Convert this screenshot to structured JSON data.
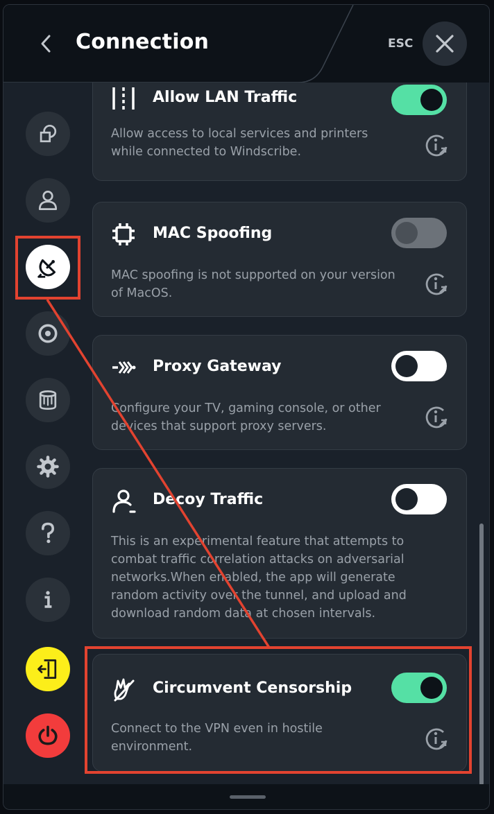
{
  "header": {
    "title": "Connection",
    "esc_label": "ESC",
    "back_icon": "chevron-left-icon",
    "close_icon": "close-icon"
  },
  "sidebar": {
    "items": [
      {
        "name": "general",
        "icon": "windows-icon"
      },
      {
        "name": "account",
        "icon": "user-icon"
      },
      {
        "name": "connection",
        "icon": "satellite-dish-icon",
        "active": true
      },
      {
        "name": "robert",
        "icon": "robert-icon"
      },
      {
        "name": "advanced",
        "icon": "database-icon"
      },
      {
        "name": "preferences",
        "icon": "gear-icon"
      },
      {
        "name": "help",
        "icon": "question-icon"
      },
      {
        "name": "about",
        "icon": "info-icon"
      },
      {
        "name": "logout",
        "icon": "exit-door-icon"
      },
      {
        "name": "quit",
        "icon": "power-icon"
      }
    ]
  },
  "settings": [
    {
      "id": "allow-lan-traffic",
      "title": "Allow LAN Traffic",
      "description": "Allow access to local services and printers while connected to Windscribe.",
      "toggle": "on",
      "icon": "lan-icon"
    },
    {
      "id": "mac-spoofing",
      "title": "MAC Spoofing",
      "description": "MAC spoofing is not supported on your version of MacOS.",
      "toggle": "disabled",
      "icon": "chip-icon"
    },
    {
      "id": "proxy-gateway",
      "title": "Proxy Gateway",
      "description": "Configure your TV, gaming console, or other devices that support proxy servers.",
      "toggle": "off",
      "icon": "proxy-icon"
    },
    {
      "id": "decoy-traffic",
      "title": "Decoy Traffic",
      "description": "This is an experimental feature that attempts to combat traffic correlation attacks on adversarial networks.When enabled, the app will generate random activity over the tunnel, and upload and download random data at chosen intervals.",
      "toggle": "off",
      "icon": "decoy-user-icon"
    },
    {
      "id": "circumvent-censorship",
      "title": "Circumvent Censorship",
      "description": "Connect to the VPN even in hostile environment.",
      "toggle": "on",
      "icon": "circumvent-hand-icon"
    }
  ],
  "colors": {
    "toggle_on": "#55e0a5",
    "annotation": "#e24330",
    "logout_button": "#fcee1a",
    "power_button": "#f23c3c"
  }
}
